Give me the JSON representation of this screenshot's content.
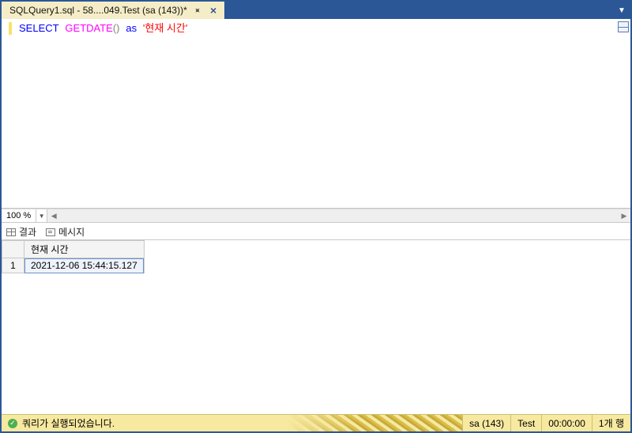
{
  "tab": {
    "title": "SQLQuery1.sql - 58....049.Test (sa (143))*"
  },
  "editor": {
    "kw_select": "SELECT",
    "fn_getdate": "GETDATE",
    "parens": "()",
    "kw_as": "as",
    "str_alias": "'현재 시간'"
  },
  "zoom": {
    "value": "100 %"
  },
  "resultTabs": {
    "results": "결과",
    "messages": "메시지"
  },
  "grid": {
    "colHeader": "현재 시간",
    "rowNum": "1",
    "cellValue": "2021-12-06 15:44:15.127"
  },
  "status": {
    "message": "쿼리가 실행되었습니다.",
    "user": "sa (143)",
    "db": "Test",
    "time": "00:00:00",
    "rows": "1개 행"
  }
}
